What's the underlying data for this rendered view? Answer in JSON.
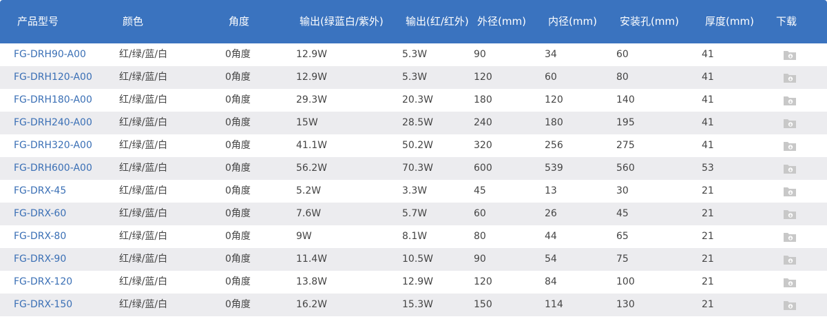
{
  "headers": [
    "产品型号",
    "颜色",
    "角度",
    "输出(绿蓝白/紫外)",
    "输出(红/红外)",
    "外径(mm)",
    "内径(mm)",
    "安装孔(mm)",
    "厚度(mm)",
    "下载"
  ],
  "rows": [
    [
      "FG-DRH90-A00",
      "红/绿/蓝/白",
      "0角度",
      "12.9W",
      "5.3W",
      "90",
      "34",
      "60",
      "41"
    ],
    [
      "FG-DRH120-A00",
      "红/绿/蓝/白",
      "0角度",
      "12.9W",
      "5.3W",
      "120",
      "60",
      "80",
      "41"
    ],
    [
      "FG-DRH180-A00",
      "红/绿/蓝/白",
      "0角度",
      "29.3W",
      "20.3W",
      "180",
      "120",
      "140",
      "41"
    ],
    [
      "FG-DRH240-A00",
      "红/绿/蓝/白",
      "0角度",
      "15W",
      "28.5W",
      "240",
      "180",
      "195",
      "41"
    ],
    [
      "FG-DRH320-A00",
      "红/绿/蓝/白",
      "0角度",
      "41.1W",
      "50.2W",
      "320",
      "256",
      "275",
      "41"
    ],
    [
      "FG-DRH600-A00",
      "红/绿/蓝/白",
      "0角度",
      "56.2W",
      "70.3W",
      "600",
      "539",
      "560",
      "53"
    ],
    [
      "FG-DRX-45",
      "红/绿/蓝/白",
      "0角度",
      "5.2W",
      "3.3W",
      "45",
      "13",
      "30",
      "21"
    ],
    [
      "FG-DRX-60",
      "红/绿/蓝/白",
      "0角度",
      "7.6W",
      "5.7W",
      "60",
      "26",
      "45",
      "21"
    ],
    [
      "FG-DRX-80",
      "红/绿/蓝/白",
      "0角度",
      "9W",
      "8.1W",
      "80",
      "44",
      "65",
      "21"
    ],
    [
      "FG-DRX-90",
      "红/绿/蓝/白",
      "0角度",
      "11.4W",
      "10.5W",
      "90",
      "54",
      "75",
      "21"
    ],
    [
      "FG-DRX-120",
      "红/绿/蓝/白",
      "0角度",
      "13.8W",
      "12.9W",
      "120",
      "84",
      "100",
      "21"
    ],
    [
      "FG-DRX-150",
      "红/绿/蓝/白",
      "0角度",
      "16.2W",
      "15.3W",
      "150",
      "114",
      "130",
      "21"
    ]
  ],
  "download_icon": "download-folder-icon",
  "colors": {
    "header_bg": "#3a73bf",
    "header_text": "#ffffff",
    "row_alt": "#ececef",
    "model_link": "#3a6fb5",
    "text": "#444444",
    "icon": "#c8c8c8"
  }
}
